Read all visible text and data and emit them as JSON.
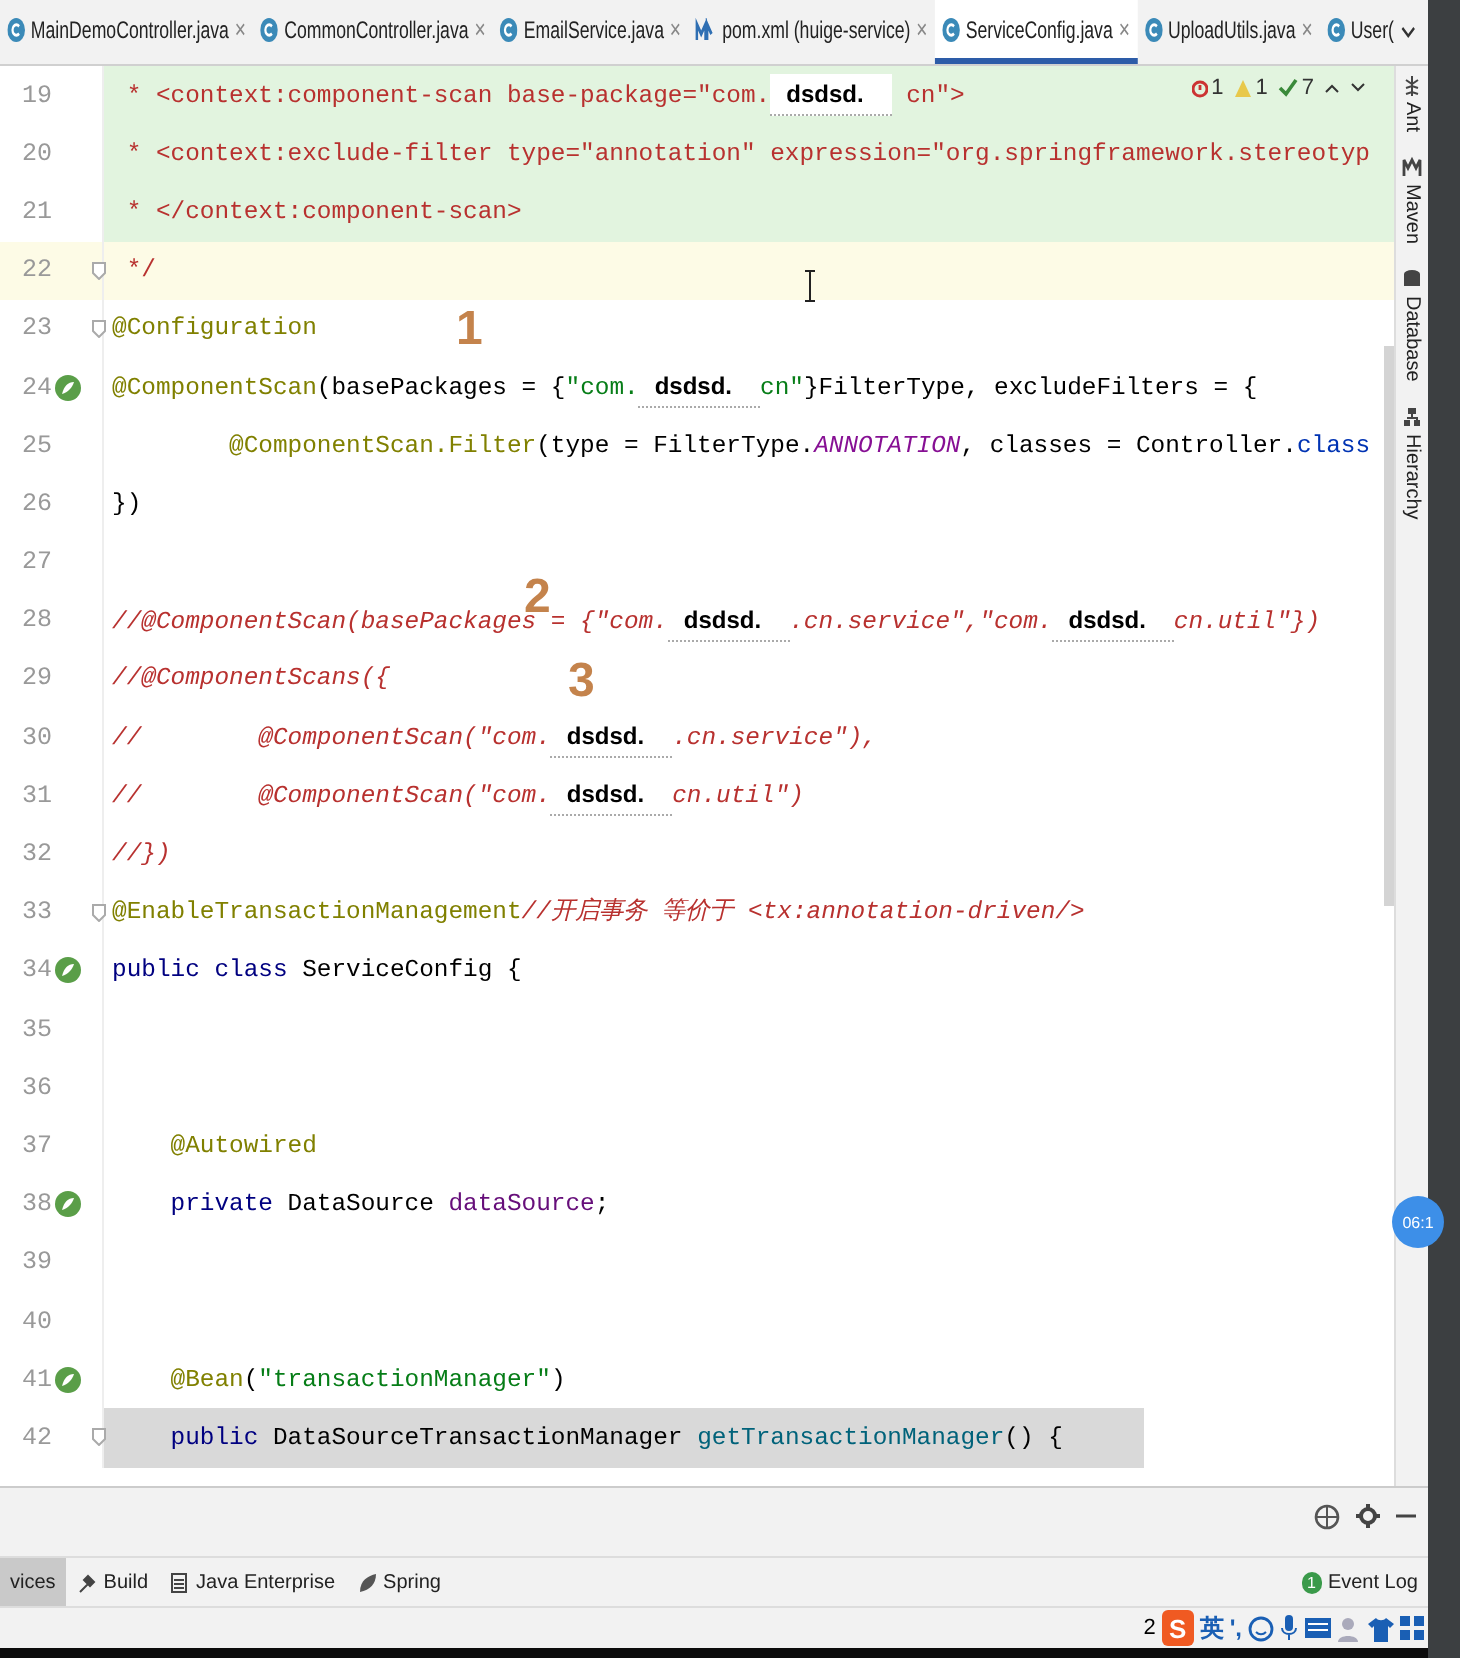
{
  "tabs": [
    {
      "label": "MainDemoController.java",
      "kind": "class",
      "selected": false,
      "closable": true
    },
    {
      "label": "CommonController.java",
      "kind": "class",
      "selected": false,
      "closable": true
    },
    {
      "label": "EmailService.java",
      "kind": "class",
      "selected": false,
      "closable": true
    },
    {
      "label": "pom.xml (huige-service)",
      "kind": "maven",
      "selected": false,
      "closable": true
    },
    {
      "label": "ServiceConfig.java",
      "kind": "class",
      "selected": true,
      "closable": true
    },
    {
      "label": "UploadUtils.java",
      "kind": "class",
      "selected": false,
      "closable": true
    },
    {
      "label": "User(",
      "kind": "class",
      "selected": false,
      "closable": false
    }
  ],
  "close_glyph": "×",
  "inspections": {
    "errors": "1",
    "warnings": "1",
    "typos": "7"
  },
  "lines": [
    {
      "number": "19",
      "changed": true,
      "caret_line": false,
      "selected": false,
      "fold": false,
      "bean_icon": false,
      "segments": [
        {
          "kind": "doc",
          "text": " * <context:component-scan base-package=\"com."
        },
        {
          "kind": "redact",
          "text": "dsdsd."
        },
        {
          "kind": "doc",
          "text": " cn\">"
        }
      ]
    },
    {
      "number": "20",
      "changed": true,
      "caret_line": false,
      "selected": false,
      "fold": false,
      "bean_icon": false,
      "segments": [
        {
          "kind": "doc",
          "text": " * <context:exclude-filter type=\"annotation\" expression=\"org.springframework.stereotyp"
        }
      ]
    },
    {
      "number": "21",
      "changed": true,
      "caret_line": false,
      "selected": false,
      "fold": false,
      "bean_icon": false,
      "segments": [
        {
          "kind": "doc",
          "text": " * </context:component-scan>"
        }
      ]
    },
    {
      "number": "22",
      "changed": false,
      "caret_line": true,
      "selected": false,
      "fold": true,
      "bean_icon": false,
      "segments": [
        {
          "kind": "doc",
          "text": " */"
        }
      ]
    },
    {
      "number": "23",
      "changed": false,
      "caret_line": false,
      "selected": false,
      "fold": true,
      "bean_icon": false,
      "segments": [
        {
          "kind": "annotation",
          "text": "@Configuration"
        }
      ]
    },
    {
      "number": "24",
      "changed": false,
      "caret_line": false,
      "selected": false,
      "fold": false,
      "bean_icon": true,
      "segments": [
        {
          "kind": "annotation",
          "text": "@ComponentScan"
        },
        {
          "kind": "plain",
          "text": "(basePackages = {"
        },
        {
          "kind": "string",
          "text": "\"com."
        },
        {
          "kind": "redact",
          "text": "dsdsd."
        },
        {
          "kind": "string",
          "text": "cn\""
        },
        {
          "kind": "plain",
          "text": "}FilterType, excludeFilters = {"
        }
      ]
    },
    {
      "number": "25",
      "changed": false,
      "caret_line": false,
      "selected": false,
      "fold": false,
      "bean_icon": false,
      "segments": [
        {
          "kind": "annotation",
          "text": "        @ComponentScan.Filter"
        },
        {
          "kind": "plain",
          "text": "(type = FilterType."
        },
        {
          "kind": "constant",
          "text": "ANNOTATION"
        },
        {
          "kind": "plain",
          "text": ", classes = Controller."
        },
        {
          "kind": "keyword2",
          "text": "class"
        }
      ]
    },
    {
      "number": "26",
      "changed": false,
      "caret_line": false,
      "selected": false,
      "fold": false,
      "bean_icon": false,
      "segments": [
        {
          "kind": "plain",
          "text": "})"
        }
      ]
    },
    {
      "number": "27",
      "changed": false,
      "caret_line": false,
      "selected": false,
      "fold": false,
      "bean_icon": false
    },
    {
      "number": "28",
      "changed": false,
      "caret_line": false,
      "selected": false,
      "fold": false,
      "bean_icon": false,
      "segments": [
        {
          "kind": "comment",
          "text": "//@ComponentScan(basePackages = {\"com."
        },
        {
          "kind": "redact",
          "text": "dsdsd."
        },
        {
          "kind": "comment",
          "text": ".cn.service\",\"com."
        },
        {
          "kind": "redact",
          "text": "dsdsd."
        },
        {
          "kind": "comment",
          "text": "cn.util\"})"
        }
      ]
    },
    {
      "number": "29",
      "changed": false,
      "caret_line": false,
      "selected": false,
      "fold": false,
      "bean_icon": false,
      "segments": [
        {
          "kind": "comment",
          "text": "//@ComponentScans({"
        }
      ]
    },
    {
      "number": "30",
      "changed": false,
      "caret_line": false,
      "selected": false,
      "fold": false,
      "bean_icon": false,
      "segments": [
        {
          "kind": "comment",
          "text": "//        @ComponentScan(\"com."
        },
        {
          "kind": "redact",
          "text": "dsdsd."
        },
        {
          "kind": "comment",
          "text": ".cn.service\"),"
        }
      ]
    },
    {
      "number": "31",
      "changed": false,
      "caret_line": false,
      "selected": false,
      "fold": false,
      "bean_icon": false,
      "segments": [
        {
          "kind": "comment",
          "text": "//        @ComponentScan(\"com."
        },
        {
          "kind": "redact",
          "text": "dsdsd."
        },
        {
          "kind": "comment",
          "text": "cn.util\")"
        }
      ]
    },
    {
      "number": "32",
      "changed": false,
      "caret_line": false,
      "selected": false,
      "fold": false,
      "bean_icon": false,
      "segments": [
        {
          "kind": "comment",
          "text": "//})"
        }
      ]
    },
    {
      "number": "33",
      "changed": false,
      "caret_line": false,
      "selected": false,
      "fold": true,
      "bean_icon": false,
      "segments": [
        {
          "kind": "annotation",
          "text": "@EnableTransactionManagement"
        },
        {
          "kind": "comment",
          "text": "//开启事务 等价于 <tx:annotation-driven/>"
        }
      ]
    },
    {
      "number": "34",
      "changed": false,
      "caret_line": false,
      "selected": false,
      "fold": false,
      "bean_icon": true,
      "segments": [
        {
          "kind": "keyword",
          "text": "public class "
        },
        {
          "kind": "plain",
          "text": "ServiceConfig {"
        }
      ]
    },
    {
      "number": "35",
      "changed": false,
      "caret_line": false,
      "selected": false,
      "fold": false,
      "bean_icon": false
    },
    {
      "number": "36",
      "changed": false,
      "caret_line": false,
      "selected": false,
      "fold": false,
      "bean_icon": false
    },
    {
      "number": "37",
      "changed": false,
      "caret_line": false,
      "selected": false,
      "fold": false,
      "bean_icon": false,
      "segments": [
        {
          "kind": "annotation",
          "text": "    @Autowired"
        }
      ]
    },
    {
      "number": "38",
      "changed": false,
      "caret_line": false,
      "selected": false,
      "fold": false,
      "bean_icon": true,
      "segments": [
        {
          "kind": "keyword",
          "text": "    private "
        },
        {
          "kind": "plain",
          "text": "DataSource "
        },
        {
          "kind": "field",
          "text": "dataSource"
        },
        {
          "kind": "plain",
          "text": ";"
        }
      ]
    },
    {
      "number": "39",
      "changed": false,
      "caret_line": false,
      "selected": false,
      "fold": false,
      "bean_icon": false
    },
    {
      "number": "40",
      "changed": false,
      "caret_line": false,
      "selected": false,
      "fold": false,
      "bean_icon": false
    },
    {
      "number": "41",
      "changed": false,
      "caret_line": false,
      "selected": false,
      "fold": false,
      "bean_icon": true,
      "segments": [
        {
          "kind": "annotation",
          "text": "    @Bean"
        },
        {
          "kind": "plain",
          "text": "("
        },
        {
          "kind": "string",
          "text": "\"transactionManager\""
        },
        {
          "kind": "plain",
          "text": ")"
        }
      ]
    },
    {
      "number": "42",
      "changed": false,
      "caret_line": false,
      "selected": true,
      "fold": true,
      "bean_icon": false,
      "segments": [
        {
          "kind": "keyword",
          "text": "    public "
        },
        {
          "kind": "plain",
          "text": "DataSourceTransactionManager "
        },
        {
          "kind": "method",
          "text": "getTransactionManager"
        },
        {
          "kind": "plain",
          "text": "() {"
        }
      ]
    }
  ],
  "step_markers": [
    "1",
    "2",
    "3"
  ],
  "right_toolbar": [
    {
      "label": "Ant",
      "kind": "ant"
    },
    {
      "label": "Maven",
      "kind": "maven"
    },
    {
      "label": "Database",
      "kind": "database"
    },
    {
      "label": "Hierarchy",
      "kind": "hierarchy"
    }
  ],
  "floating_badge": "06:1",
  "tool_windows": [
    {
      "label": "vices",
      "kind": "services",
      "selected": true
    },
    {
      "label": "Build",
      "kind": "build",
      "selected": false
    },
    {
      "label": "Java Enterprise",
      "kind": "enterprise",
      "selected": false
    },
    {
      "label": "Spring",
      "kind": "spring",
      "selected": false
    }
  ],
  "event_log": {
    "label": "Event Log",
    "count": "1"
  },
  "status_text": "2",
  "ime": {
    "logo": "S",
    "language": "英",
    "punctuation": "',"
  }
}
